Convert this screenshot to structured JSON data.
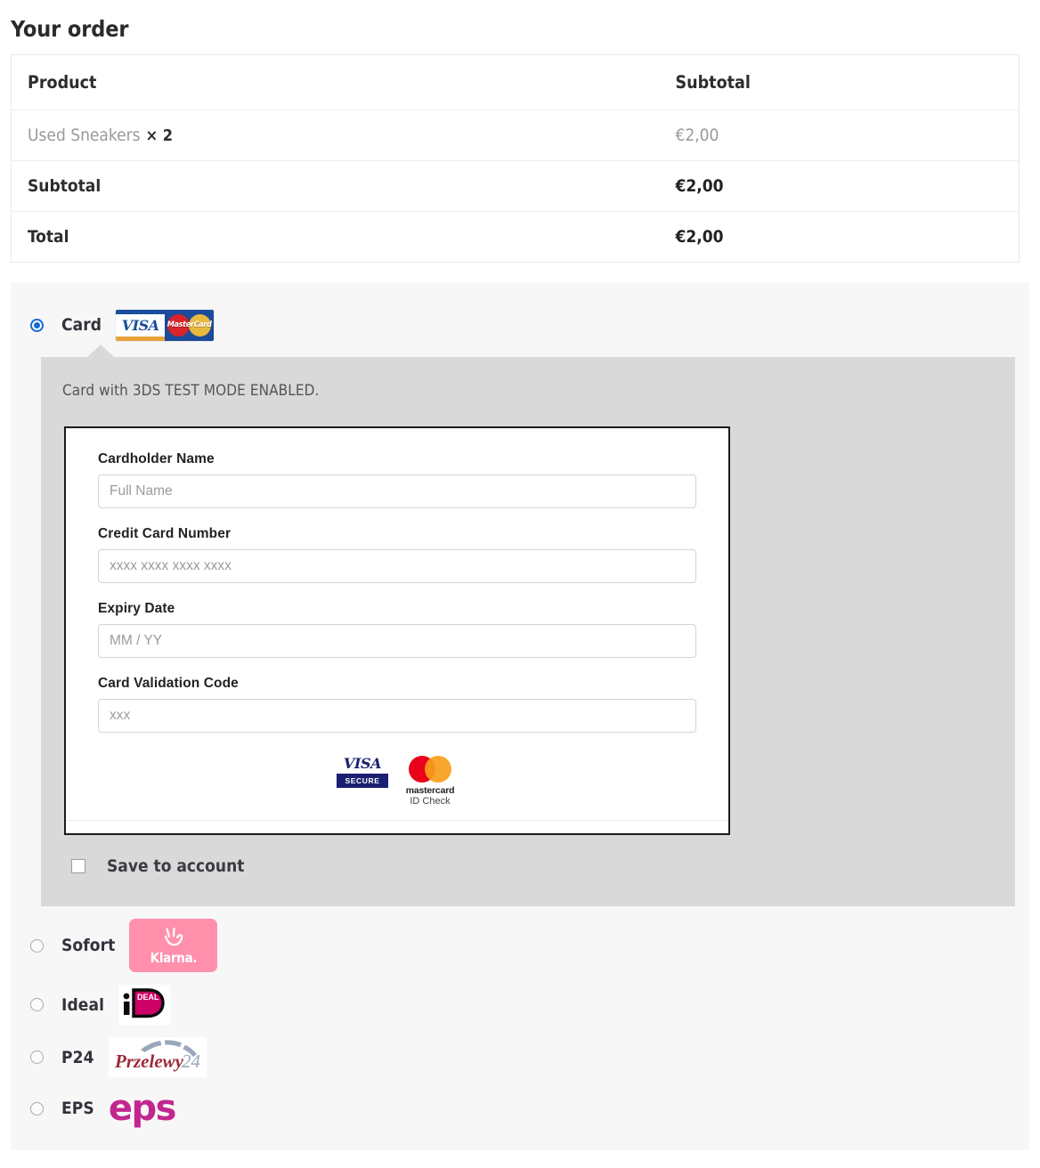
{
  "order": {
    "heading": "Your order",
    "columns": {
      "product": "Product",
      "subtotal": "Subtotal"
    },
    "line_items": [
      {
        "name": "Used Sneakers",
        "quantity": "× 2",
        "amount": "€2,00"
      }
    ],
    "totals": [
      {
        "label": "Subtotal",
        "amount": "€2,00"
      },
      {
        "label": "Total",
        "amount": "€2,00"
      }
    ]
  },
  "payment_methods": [
    {
      "id": "card",
      "label": "Card",
      "selected": true,
      "logo": "visa-mastercard-logo",
      "logo_text": {
        "visa": "VISA",
        "mastercard": "MasterCard"
      }
    },
    {
      "id": "sofort",
      "label": "Sofort",
      "selected": false,
      "logo": "klarna-logo",
      "logo_text": {
        "name": "Klarna.",
        "icon": "peace-hand"
      }
    },
    {
      "id": "ideal",
      "label": "Ideal",
      "selected": false,
      "logo": "ideal-logo",
      "logo_text": {
        "name": "iDEAL"
      }
    },
    {
      "id": "p24",
      "label": "P24",
      "selected": false,
      "logo": "przelewy24-logo",
      "logo_text": {
        "word": "Przelewy",
        "number": "24"
      }
    },
    {
      "id": "eps",
      "label": "EPS",
      "selected": false,
      "logo": "eps-logo",
      "logo_text": {
        "name": "eps"
      }
    }
  ],
  "card_panel": {
    "note": "Card with 3DS TEST MODE ENABLED.",
    "fields": [
      {
        "id": "cardholder-name",
        "label": "Cardholder Name",
        "placeholder": "Full Name",
        "value": ""
      },
      {
        "id": "credit-card-number",
        "label": "Credit Card Number",
        "placeholder": "xxxx xxxx xxxx xxxx",
        "value": ""
      },
      {
        "id": "expiry-date",
        "label": "Expiry Date",
        "placeholder": "MM / YY",
        "value": ""
      },
      {
        "id": "card-validation-code",
        "label": "Card Validation Code",
        "placeholder": "xxx",
        "value": ""
      }
    ],
    "security_badges": {
      "visa_secure": {
        "brand": "VISA",
        "tag": "SECURE"
      },
      "mastercard_idcheck": {
        "brand": "mastercard",
        "tag": "ID Check"
      }
    },
    "save_to_account": {
      "label": "Save to account",
      "checked": false
    }
  },
  "colors": {
    "radio_selected": "#1769d6",
    "panel_background": "#f7f7f8",
    "card_box_background": "#d9d9d9",
    "klarna_pink": "#ff8fab",
    "ideal_magenta": "#cc0066",
    "eps_magenta": "#c2268f",
    "mastercard_red": "#eb001b",
    "mastercard_yellow": "#f79e1b",
    "visa_navy": "#1a1f71",
    "przelewy_red": "#9c2a3a"
  }
}
